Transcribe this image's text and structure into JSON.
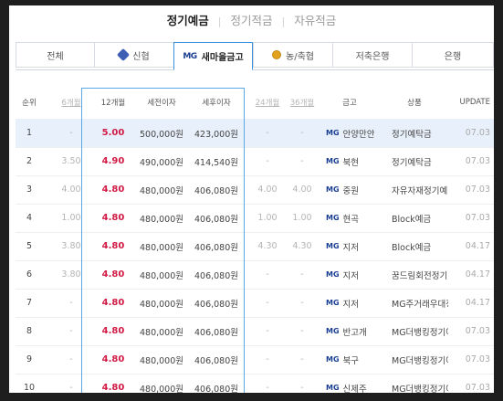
{
  "product_tabs": [
    "정기예금",
    "정기적금",
    "자유적금"
  ],
  "bank_tabs": [
    {
      "label": "전체",
      "icon": ""
    },
    {
      "label": "신협",
      "icon": "shinhan-diamond-icon"
    },
    {
      "label": "새마을금고",
      "icon": "mg-logo-icon",
      "prefix": "MG"
    },
    {
      "label": "농/축협",
      "icon": "nh-coin-icon"
    },
    {
      "label": "저축은행",
      "icon": ""
    },
    {
      "label": "은행",
      "icon": ""
    }
  ],
  "table": {
    "headers": {
      "rank": "순위",
      "m6": "6개월",
      "m12": "12개월",
      "pretax": "세전이자",
      "posttax": "세후이자",
      "m24": "24개월",
      "m36": "36개월",
      "bank": "금고",
      "product": "상품",
      "update": "UPDATE"
    },
    "rows": [
      {
        "rank": "1",
        "m6": "-",
        "m12": "5.00",
        "pretax": "500,000원",
        "posttax": "423,000원",
        "m24": "-",
        "m36": "-",
        "bank_prefix": "MG",
        "bank": "안양만안",
        "product": "정기예탁금",
        "update": "07.03"
      },
      {
        "rank": "2",
        "m6": "3.50",
        "m12": "4.90",
        "pretax": "490,000원",
        "posttax": "414,540원",
        "m24": "-",
        "m36": "-",
        "bank_prefix": "MG",
        "bank": "북현",
        "product": "정기예탁금",
        "update": "07.03"
      },
      {
        "rank": "3",
        "m6": "4.00",
        "m12": "4.80",
        "pretax": "480,000원",
        "posttax": "406,080원",
        "m24": "4.00",
        "m36": "4.00",
        "bank_prefix": "MG",
        "bank": "중원",
        "product": "자유자재정기예…",
        "update": "07.03"
      },
      {
        "rank": "4",
        "m6": "1.00",
        "m12": "4.80",
        "pretax": "480,000원",
        "posttax": "406,080원",
        "m24": "1.00",
        "m36": "1.00",
        "bank_prefix": "MG",
        "bank": "현곡",
        "product": "Block예금",
        "update": "07.03"
      },
      {
        "rank": "5",
        "m6": "3.80",
        "m12": "4.80",
        "pretax": "480,000원",
        "posttax": "406,080원",
        "m24": "4.30",
        "m36": "4.30",
        "bank_prefix": "MG",
        "bank": "지저",
        "product": "Block예금",
        "update": "04.17"
      },
      {
        "rank": "6",
        "m6": "3.80",
        "m12": "4.80",
        "pretax": "480,000원",
        "posttax": "406,080원",
        "m24": "-",
        "m36": "-",
        "bank_prefix": "MG",
        "bank": "지저",
        "product": "꿈드림회전정기…",
        "update": "04.17"
      },
      {
        "rank": "7",
        "m6": "-",
        "m12": "4.80",
        "pretax": "480,000원",
        "posttax": "406,080원",
        "m24": "-",
        "m36": "-",
        "bank_prefix": "MG",
        "bank": "지저",
        "product": "MG주거래우대정…",
        "update": "04.17"
      },
      {
        "rank": "8",
        "m6": "-",
        "m12": "4.80",
        "pretax": "480,000원",
        "posttax": "406,080원",
        "m24": "-",
        "m36": "-",
        "bank_prefix": "MG",
        "bank": "반고개",
        "product": "MG더뱅킹정기예금",
        "update": "07.03"
      },
      {
        "rank": "9",
        "m6": "-",
        "m12": "4.80",
        "pretax": "480,000원",
        "posttax": "406,080원",
        "m24": "-",
        "m36": "-",
        "bank_prefix": "MG",
        "bank": "북구",
        "product": "MG더뱅킹정기예금",
        "update": "07.03"
      },
      {
        "rank": "10",
        "m6": "-",
        "m12": "4.80",
        "pretax": "480,000원",
        "posttax": "406,080원",
        "m24": "-",
        "m36": "-",
        "bank_prefix": "MG",
        "bank": "신제주",
        "product": "MG더뱅킹정기예금",
        "update": "07.03"
      }
    ]
  },
  "colors": {
    "accent": "#3a8fd9",
    "rate": "#d11a45",
    "highlight_row": "#e8f1fb",
    "mg_blue": "#1a3f92"
  }
}
